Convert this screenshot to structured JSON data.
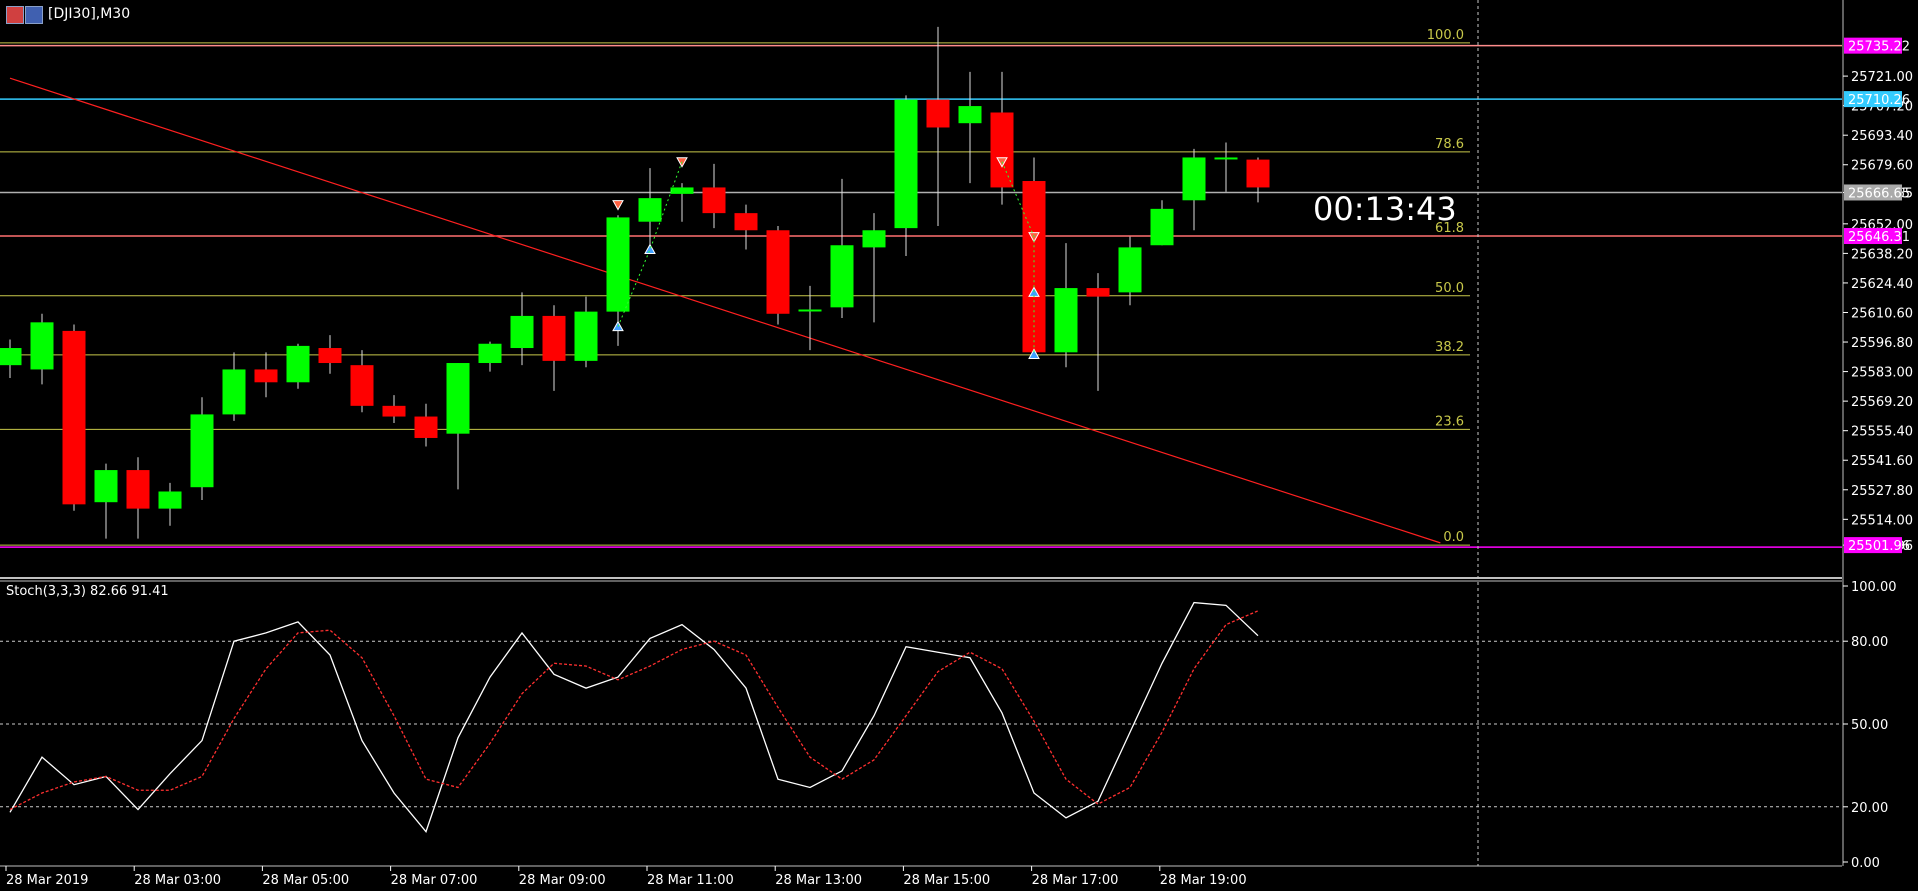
{
  "window": {
    "title": "[DJI30],M30",
    "timer": "00:13:43"
  },
  "colors": {
    "bull": "#00ff00",
    "bear": "#ff0000",
    "wick": "#dddddd",
    "fib": "#c8c84a",
    "trend": "#ff2020",
    "top_line": "#ff8c8c",
    "high_line": "#33ccff",
    "mid_line": "#b0b0b0",
    "fib618_line": "#ff7070",
    "magenta_tag": "#ff00ff",
    "cyan_tag": "#33ccff",
    "gray_tag": "#aaaaaa",
    "stoch_main": "#ffffff",
    "stoch_signal": "#ff3030",
    "grid": "#cccccc",
    "divider": "#c0c0c0"
  },
  "chart_data": [
    {
      "type": "candlestick",
      "title": "[DJI30],M30",
      "ylim": [
        25488.0,
        25750.0
      ],
      "price_ticks": [
        "25721.00",
        "25707.20",
        "25693.40",
        "25679.60",
        "25666.65",
        "25652.00",
        "25638.20",
        "25624.40",
        "25610.60",
        "25596.80",
        "25583.00",
        "25569.20",
        "25555.40",
        "25541.60",
        "25527.80",
        "25514.00",
        "25501.96"
      ],
      "price_tags": [
        {
          "label": "25735.22",
          "value": 25735.22,
          "color": "#ff00ff"
        },
        {
          "label": "25710.26",
          "value": 25710.26,
          "color": "#33ccff"
        },
        {
          "label": "25666.65",
          "value": 25666.65,
          "color": "#aaaaaa"
        },
        {
          "label": "25646.31",
          "value": 25646.31,
          "color": "#ff00ff"
        },
        {
          "label": "25501.96",
          "value": 25501.96,
          "color": "#ff00ff"
        }
      ],
      "horizontal_lines": [
        {
          "value": 25735.22,
          "color": "#ff8c8c"
        },
        {
          "value": 25710.26,
          "color": "#33ccff"
        },
        {
          "value": 25666.65,
          "color": "#b0b0b0"
        },
        {
          "value": 25646.31,
          "color": "#ff7070"
        }
      ],
      "fibonacci": [
        {
          "label": "100.0",
          "value": 25736.5
        },
        {
          "label": "78.6",
          "value": 25685.6
        },
        {
          "label": "61.8",
          "value": 25646.3
        },
        {
          "label": "50.0",
          "value": 25618.4
        },
        {
          "label": "38.2",
          "value": 25590.8
        },
        {
          "label": "23.6",
          "value": 25556.0
        },
        {
          "label": "0.0",
          "value": 25501.96
        }
      ],
      "x_labels": [
        "28 Mar 2019",
        "28 Mar 03:00",
        "28 Mar 05:00",
        "28 Mar 07:00",
        "28 Mar 09:00",
        "28 Mar 11:00",
        "28 Mar 13:00",
        "28 Mar 15:00",
        "28 Mar 17:00",
        "28 Mar 19:00"
      ],
      "trendline": {
        "from": {
          "bar": 0,
          "value": 25720.0
        },
        "to": {
          "bar": 44.7,
          "value": 25503.0
        }
      },
      "candles": [
        {
          "o": 25586,
          "h": 25598,
          "l": 25580,
          "c": 25594
        },
        {
          "o": 25584,
          "h": 25610,
          "l": 25577,
          "c": 25606
        },
        {
          "o": 25602,
          "h": 25605,
          "l": 25518,
          "c": 25521
        },
        {
          "o": 25522,
          "h": 25540,
          "l": 25505,
          "c": 25537
        },
        {
          "o": 25537,
          "h": 25543,
          "l": 25505,
          "c": 25519
        },
        {
          "o": 25519,
          "h": 25531,
          "l": 25511,
          "c": 25527
        },
        {
          "o": 25529,
          "h": 25571,
          "l": 25523,
          "c": 25563
        },
        {
          "o": 25563,
          "h": 25592,
          "l": 25560,
          "c": 25584
        },
        {
          "o": 25584,
          "h": 25592,
          "l": 25571,
          "c": 25578
        },
        {
          "o": 25578,
          "h": 25596,
          "l": 25575,
          "c": 25595
        },
        {
          "o": 25594,
          "h": 25600,
          "l": 25582,
          "c": 25587
        },
        {
          "o": 25586,
          "h": 25593,
          "l": 25564,
          "c": 25567
        },
        {
          "o": 25567,
          "h": 25572,
          "l": 25559,
          "c": 25562
        },
        {
          "o": 25562,
          "h": 25568,
          "l": 25548,
          "c": 25552
        },
        {
          "o": 25554,
          "h": 25587,
          "l": 25528,
          "c": 25587
        },
        {
          "o": 25587,
          "h": 25597,
          "l": 25583,
          "c": 25596
        },
        {
          "o": 25594,
          "h": 25620,
          "l": 25586,
          "c": 25609
        },
        {
          "o": 25609,
          "h": 25614,
          "l": 25574,
          "c": 25588
        },
        {
          "o": 25588,
          "h": 25618,
          "l": 25585,
          "c": 25611
        },
        {
          "o": 25611,
          "h": 25656,
          "l": 25595,
          "c": 25655
        },
        {
          "o": 25653,
          "h": 25678,
          "l": 25640,
          "c": 25664
        },
        {
          "o": 25666,
          "h": 25671,
          "l": 25653,
          "c": 25669
        },
        {
          "o": 25669,
          "h": 25680,
          "l": 25650,
          "c": 25657
        },
        {
          "o": 25657,
          "h": 25661,
          "l": 25640,
          "c": 25649
        },
        {
          "o": 25649,
          "h": 25651,
          "l": 25605,
          "c": 25610
        },
        {
          "o": 25612,
          "h": 25623,
          "l": 25593,
          "c": 25612
        },
        {
          "o": 25613,
          "h": 25673,
          "l": 25608,
          "c": 25642
        },
        {
          "o": 25641,
          "h": 25657,
          "l": 25606,
          "c": 25649
        },
        {
          "o": 25650,
          "h": 25712,
          "l": 25637,
          "c": 25710
        },
        {
          "o": 25710,
          "h": 25744,
          "l": 25651,
          "c": 25697
        },
        {
          "o": 25699,
          "h": 25723,
          "l": 25671,
          "c": 25707
        },
        {
          "o": 25704,
          "h": 25723,
          "l": 25661,
          "c": 25669
        },
        {
          "o": 25672,
          "h": 25683,
          "l": 25591,
          "c": 25592
        },
        {
          "o": 25592,
          "h": 25643,
          "l": 25585,
          "c": 25622
        },
        {
          "o": 25622,
          "h": 25629,
          "l": 25574,
          "c": 25618
        },
        {
          "o": 25620,
          "h": 25646,
          "l": 25614,
          "c": 25641
        },
        {
          "o": 25642,
          "h": 25663,
          "l": 25642,
          "c": 25659
        },
        {
          "o": 25663,
          "h": 25687,
          "l": 25649,
          "c": 25683
        },
        {
          "o": 25683,
          "h": 25690,
          "l": 25667,
          "c": 25683
        },
        {
          "o": 25682,
          "h": 25683,
          "l": 25662,
          "c": 25669
        }
      ],
      "markers": [
        {
          "bar": 19,
          "value": 25661,
          "dir": "down"
        },
        {
          "bar": 19,
          "value": 25604,
          "dir": "up"
        },
        {
          "bar": 20,
          "value": 25640,
          "dir": "up"
        },
        {
          "bar": 21,
          "value": 25681,
          "dir": "down"
        },
        {
          "bar": 31,
          "value": 25681,
          "dir": "down"
        },
        {
          "bar": 32,
          "value": 25646,
          "dir": "down"
        },
        {
          "bar": 32,
          "value": 25620,
          "dir": "up"
        },
        {
          "bar": 32,
          "value": 25591,
          "dir": "up"
        }
      ]
    },
    {
      "type": "line",
      "title": "Stoch(3,3,3) 82.66 91.41",
      "name": "Stoch(3,3,3)",
      "main_value": "82.66",
      "signal_value": "91.41",
      "ylim": [
        0,
        100
      ],
      "y_ticks": [
        "100.00",
        "80.00",
        "50.00",
        "20.00",
        "0.00"
      ],
      "grid_levels": [
        80,
        50,
        20
      ],
      "series": [
        {
          "name": "main",
          "style": "solid",
          "color": "#ffffff",
          "values": [
            18,
            38,
            28,
            31,
            19,
            32,
            44,
            80,
            83,
            87,
            75,
            44,
            25,
            11,
            45,
            67,
            83,
            68,
            63,
            67,
            81,
            86,
            77,
            63,
            30,
            27,
            33,
            53,
            78,
            76,
            74,
            54,
            25,
            16,
            22,
            47,
            72,
            94,
            93,
            82
          ]
        },
        {
          "name": "signal",
          "style": "dashed",
          "color": "#ff3030",
          "values": [
            19,
            25,
            29,
            31,
            26,
            26,
            31,
            52,
            70,
            83,
            84,
            74,
            53,
            30,
            27,
            43,
            61,
            72,
            71,
            66,
            71,
            77,
            80,
            75,
            56,
            38,
            30,
            37,
            53,
            69,
            76,
            70,
            51,
            30,
            21,
            27,
            47,
            70,
            86,
            91
          ]
        }
      ]
    }
  ]
}
